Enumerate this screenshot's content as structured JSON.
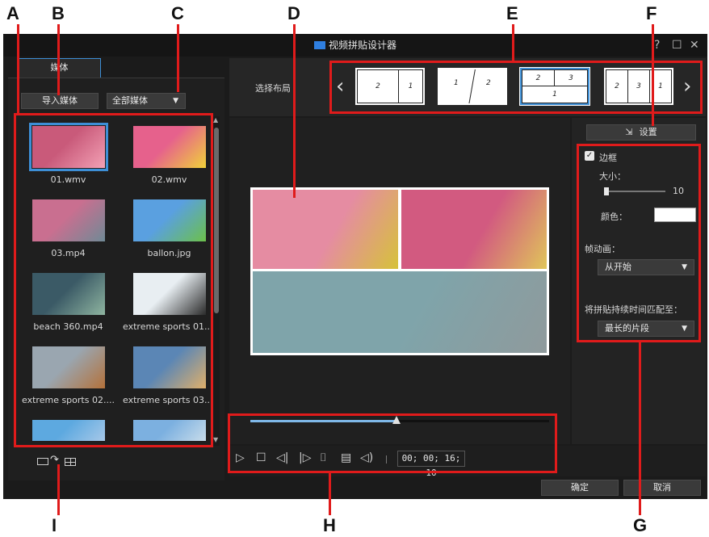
{
  "callouts": [
    "A",
    "B",
    "C",
    "D",
    "E",
    "F",
    "G",
    "H",
    "I"
  ],
  "window": {
    "title": "视频拼贴设计器",
    "help": "?",
    "maximize": "☐",
    "close": "✕"
  },
  "media_panel": {
    "tab": "媒体",
    "import_button": "导入媒体",
    "filter_select": "全部媒体",
    "items": [
      {
        "name": "01.wmv",
        "color1": "#c95a7a",
        "color2": "#f3a1b5"
      },
      {
        "name": "02.wmv",
        "color1": "#e6618c",
        "color2": "#f0d23a"
      },
      {
        "name": "03.mp4",
        "color1": "#c96f90",
        "color2": "#6f8a96"
      },
      {
        "name": "ballon.jpg",
        "color1": "#5aa0e0",
        "color2": "#6cc04a"
      },
      {
        "name": "beach 360.mp4",
        "color1": "#3b5a66",
        "color2": "#8fb5a0"
      },
      {
        "name": "extreme sports 01....",
        "color1": "#e8eef2",
        "color2": "#2a2a2a"
      },
      {
        "name": "extreme sports 02....",
        "color1": "#9aa6b0",
        "color2": "#b4713a"
      },
      {
        "name": "extreme sports 03....",
        "color1": "#5b86b5",
        "color2": "#e0b06a"
      },
      {
        "name": "",
        "color1": "#5da9e0",
        "color2": "#a7c8e8"
      },
      {
        "name": "",
        "color1": "#7cb0e0",
        "color2": "#c8dcea"
      }
    ]
  },
  "layout_bar": {
    "label": "选择布局",
    "prev": "‹",
    "next": "›",
    "layouts": [
      {
        "cells": [
          "2",
          "1"
        ]
      },
      {
        "cells": [
          "1",
          "2"
        ]
      },
      {
        "cells": [
          "2",
          "3",
          "1"
        ]
      },
      {
        "cells": [
          "2",
          "3",
          "1"
        ]
      }
    ]
  },
  "preview": {
    "cells": [
      {
        "color1": "#e58ca2",
        "color2": "#d6c23a"
      },
      {
        "color1": "#d25a80",
        "color2": "#e0c55a"
      },
      {
        "color1": "#7fa4aa",
        "color2": "#8f9a9c"
      }
    ],
    "progress": 0.49
  },
  "settings": {
    "button": "设置",
    "border_label": "边框",
    "size_label": "大小：",
    "size_value": "10",
    "size_slider": 0.0,
    "color_label": "颜色：",
    "color_value": "#ffffff",
    "animation_label": "帧动画：",
    "animation_select": "从开始",
    "match_label": "将拼贴持续时间匹配至：",
    "match_select": "最长的片段"
  },
  "playback": {
    "timecode": "00; 00; 16; 10"
  },
  "footer": {
    "ok": "确定",
    "cancel": "取消"
  },
  "colors": {
    "accent": "#3d8fd6",
    "callout": "#e01b1b"
  }
}
